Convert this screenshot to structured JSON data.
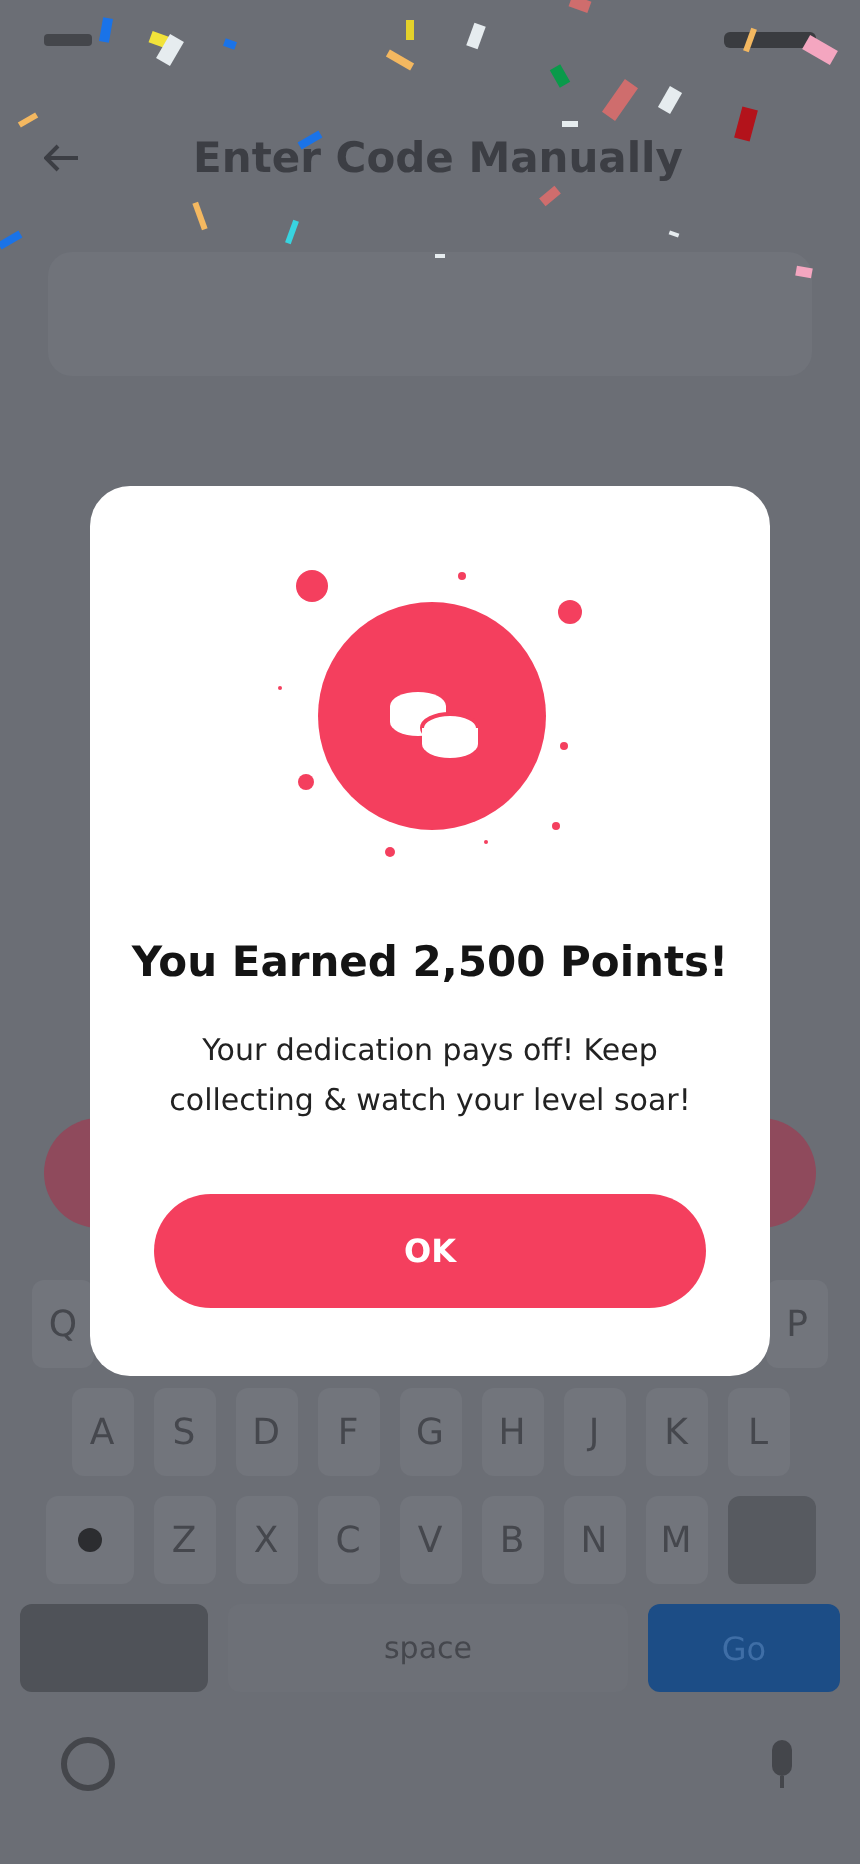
{
  "header": {
    "title": "Enter Code Manually"
  },
  "keyboard": {
    "key_rows": [
      {
        "keys": [
          "Q",
          "P"
        ]
      },
      {
        "keys": [
          "A",
          "S",
          "D",
          "F",
          "G",
          "H",
          "J",
          "K",
          "L"
        ]
      },
      {
        "keys": [
          "Z",
          "X",
          "C",
          "V",
          "B",
          "N",
          "M"
        ]
      }
    ],
    "space": "space",
    "go": "Go"
  },
  "modal": {
    "title": "You Earned 2,500 Points!",
    "message": "Your dedication pays off! Keep collecting & watch your level soar!",
    "button": "OK"
  }
}
